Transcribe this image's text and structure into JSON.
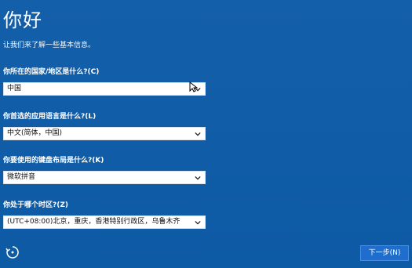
{
  "page": {
    "title": "你好",
    "subtitle": "让我们来了解一些基本信息。"
  },
  "fields": [
    {
      "label": "你所在的国家/地区是什么?(C)",
      "value": "中国"
    },
    {
      "label": "你首选的应用语言是什么?(L)",
      "value": "中文(简体，中国)"
    },
    {
      "label": "你要使用的键盘布局是什么?(K)",
      "value": "微软拼音"
    },
    {
      "label": "你处于哪个时区?(Z)",
      "value": "(UTC+08:00)北京，重庆，香港特别行政区，乌鲁木齐"
    }
  ],
  "footer": {
    "next_label": "下一步(N)",
    "accessibility_icon": "accessibility-icon"
  },
  "colors": {
    "background": "#0f5ca8",
    "button": "#1f6dcc",
    "field_bg": "#ffffff"
  }
}
